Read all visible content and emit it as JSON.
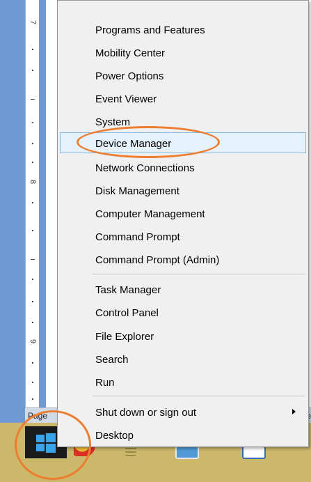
{
  "ruler": {
    "numbers": [
      "7",
      "8",
      "9"
    ]
  },
  "status_bar": {
    "page_label": "Page",
    "right_label": "te"
  },
  "context_menu": {
    "group1": [
      {
        "label": "Programs and Features"
      },
      {
        "label": "Mobility Center"
      },
      {
        "label": "Power Options"
      },
      {
        "label": "Event Viewer"
      },
      {
        "label": "System"
      },
      {
        "label": "Device Manager"
      },
      {
        "label": "Network Connections"
      },
      {
        "label": "Disk Management"
      },
      {
        "label": "Computer Management"
      },
      {
        "label": "Command Prompt"
      },
      {
        "label": "Command Prompt (Admin)"
      }
    ],
    "group2": [
      {
        "label": "Task Manager"
      },
      {
        "label": "Control Panel"
      },
      {
        "label": "File Explorer"
      },
      {
        "label": "Search"
      },
      {
        "label": "Run"
      }
    ],
    "group3": [
      {
        "label": "Shut down or sign out"
      },
      {
        "label": "Desktop"
      }
    ]
  },
  "colors": {
    "annotation": "#ed7d31",
    "highlight_bg": "#e5f1fb",
    "highlight_border": "#7fb6e5",
    "taskbar": "#cbb86a",
    "windows_logo": "#3ba4e8"
  },
  "icons": {
    "start": "windows-logo-icon",
    "submenu": "submenu-arrow-icon"
  }
}
